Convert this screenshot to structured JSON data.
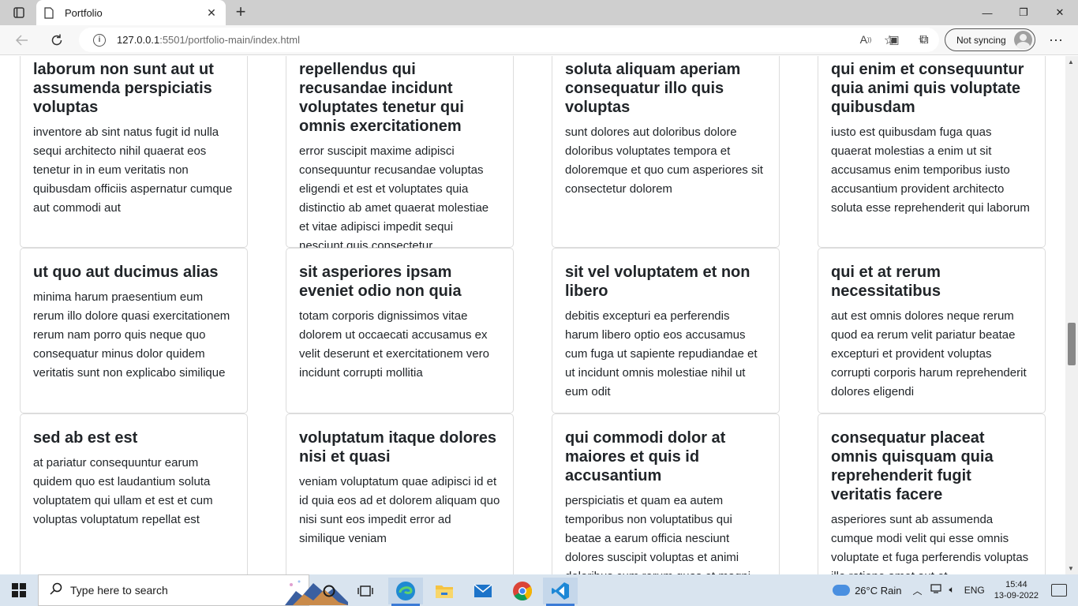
{
  "browser": {
    "tab_title": "Portfolio",
    "tab_close": "✕",
    "new_tab": "+",
    "url_host": "127.0.0.1",
    "url_path": ":5501/portfolio-main/index.html",
    "sync_label": "Not syncing",
    "minimize": "—",
    "maximize": "❐",
    "close": "✕"
  },
  "cards": [
    {
      "title": "laborum non sunt aut ut assumenda perspiciatis voluptas",
      "body": "inventore ab sint natus fugit id nulla sequi architecto nihil quaerat eos tenetur in in eum veritatis non quibusdam officiis aspernatur cumque aut commodi aut"
    },
    {
      "title": "repellendus qui recusandae incidunt voluptates tenetur qui omnis exercitationem",
      "body": "error suscipit maxime adipisci consequuntur recusandae voluptas eligendi et est et voluptates quia distinctio ab amet quaerat molestiae et vitae adipisci impedit sequi nesciunt quis consectetur"
    },
    {
      "title": "soluta aliquam aperiam consequatur illo quis voluptas",
      "body": "sunt dolores aut doloribus dolore doloribus voluptates tempora et doloremque et quo cum asperiores sit consectetur dolorem"
    },
    {
      "title": "qui enim et consequuntur quia animi quis voluptate quibusdam",
      "body": "iusto est quibusdam fuga quas quaerat molestias a enim ut sit accusamus enim temporibus iusto accusantium provident architecto soluta esse reprehenderit qui laborum"
    },
    {
      "title": "ut quo aut ducimus alias",
      "body": "minima harum praesentium eum rerum illo dolore quasi exercitationem rerum nam porro quis neque quo consequatur minus dolor quidem veritatis sunt non explicabo similique"
    },
    {
      "title": "sit asperiores ipsam eveniet odio non quia",
      "body": "totam corporis dignissimos vitae dolorem ut occaecati accusamus ex velit deserunt et exercitationem vero incidunt corrupti mollitia"
    },
    {
      "title": "sit vel voluptatem et non libero",
      "body": "debitis excepturi ea perferendis harum libero optio eos accusamus cum fuga ut sapiente repudiandae et ut incidunt omnis molestiae nihil ut eum odit"
    },
    {
      "title": "qui et at rerum necessitatibus",
      "body": "aut est omnis dolores neque rerum quod ea rerum velit pariatur beatae excepturi et provident voluptas corrupti corporis harum reprehenderit dolores eligendi"
    },
    {
      "title": "sed ab est est",
      "body": "at pariatur consequuntur earum quidem quo est laudantium soluta voluptatem qui ullam et est et cum voluptas voluptatum repellat est"
    },
    {
      "title": "voluptatum itaque dolores nisi et quasi",
      "body": "veniam voluptatum quae adipisci id et id quia eos ad et dolorem aliquam quo nisi sunt eos impedit error ad similique veniam"
    },
    {
      "title": "qui commodi dolor at maiores et quis id accusantium",
      "body": "perspiciatis et quam ea autem temporibus non voluptatibus qui beatae a earum officia nesciunt dolores suscipit voluptas et animi doloribus cum rerum quas et magni"
    },
    {
      "title": "consequatur placeat omnis quisquam quia reprehenderit fugit veritatis facere",
      "body": "asperiores sunt ab assumenda cumque modi velit qui esse omnis voluptate et fuga perferendis voluptas illo ratione amet aut et"
    }
  ],
  "taskbar": {
    "search_placeholder": "Type here to search",
    "weather": "26°C  Rain",
    "language": "ENG",
    "time": "15:44",
    "date": "13-09-2022"
  }
}
